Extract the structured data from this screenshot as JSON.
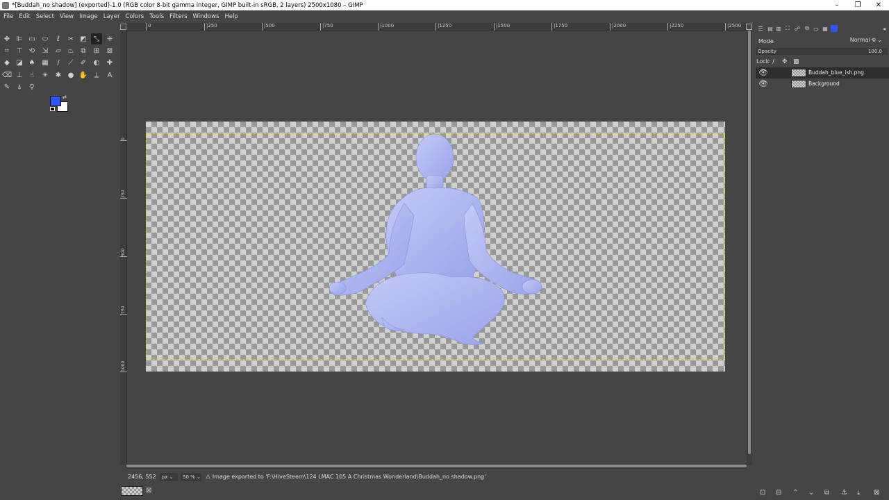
{
  "window": {
    "title": "*[Buddah_no shadow] (exported)-1.0 (RGB color 8-bit gamma integer, GIMP built-in sRGB, 2 layers) 2500x1080 – GIMP",
    "controls": {
      "minimize": "–",
      "maximize": "❐",
      "close": "✕"
    }
  },
  "menu": [
    "File",
    "Edit",
    "Select",
    "View",
    "Image",
    "Layer",
    "Colors",
    "Tools",
    "Filters",
    "Windows",
    "Help"
  ],
  "toolbox": {
    "icons": [
      "move-icon",
      "align-icon",
      "rect-select-icon",
      "ellipse-select-icon",
      "free-select-icon",
      "fuzzy-select-icon",
      "foreground-select-icon",
      "paths-icon",
      "scissors-icon",
      "crop-icon",
      "unified-transform-icon",
      "rotate-icon",
      "scale-icon",
      "shear-icon",
      "perspective-icon",
      "flip-icon",
      "cage-icon",
      "warp-icon",
      "bucket-fill-icon",
      "gradient-icon",
      "paintbrush-icon",
      "pencil-icon",
      "airbrush-icon",
      "ink-icon",
      "mypaint-icon",
      "clone-icon",
      "heal-icon",
      "eraser-icon",
      "smudge-icon",
      "blur-icon",
      "dodge-icon",
      "text-icon",
      "color-picker-icon",
      "measure-icon",
      "zoom-icon",
      "path-icon"
    ],
    "foreground_color": "#2f55ee",
    "background_color": "#ffffff"
  },
  "canvas": {
    "h_ruler": [
      {
        "label": "0"
      },
      {
        "label": "|250"
      },
      {
        "label": "|500"
      },
      {
        "label": "|750"
      },
      {
        "label": "|1000"
      },
      {
        "label": "|1250"
      },
      {
        "label": "|1500"
      },
      {
        "label": "|1750"
      },
      {
        "label": "|2000"
      },
      {
        "label": "|2250"
      },
      {
        "label": "|2500"
      }
    ],
    "v_ruler": [
      {
        "label": "0"
      },
      {
        "label": "250"
      },
      {
        "label": "500"
      },
      {
        "label": "750"
      },
      {
        "label": "1000"
      }
    ]
  },
  "status": {
    "coords": "2456, 552",
    "unit": "px",
    "zoom": "50 %",
    "message": "Image exported to 'F:\\HiveSteem\\124 LMAC 105 A Christmas Wonderland\\Buddah_no shadow.png'"
  },
  "layers_panel": {
    "mode_label": "Mode",
    "mode_value": "Normal",
    "opacity_label": "Opacity",
    "opacity_value": "100.0",
    "lock_label": "Lock:",
    "layers": [
      {
        "name": "Buddah_blue_ish.png",
        "visible": true,
        "selected": true
      },
      {
        "name": "Background",
        "visible": true,
        "selected": false
      }
    ]
  }
}
